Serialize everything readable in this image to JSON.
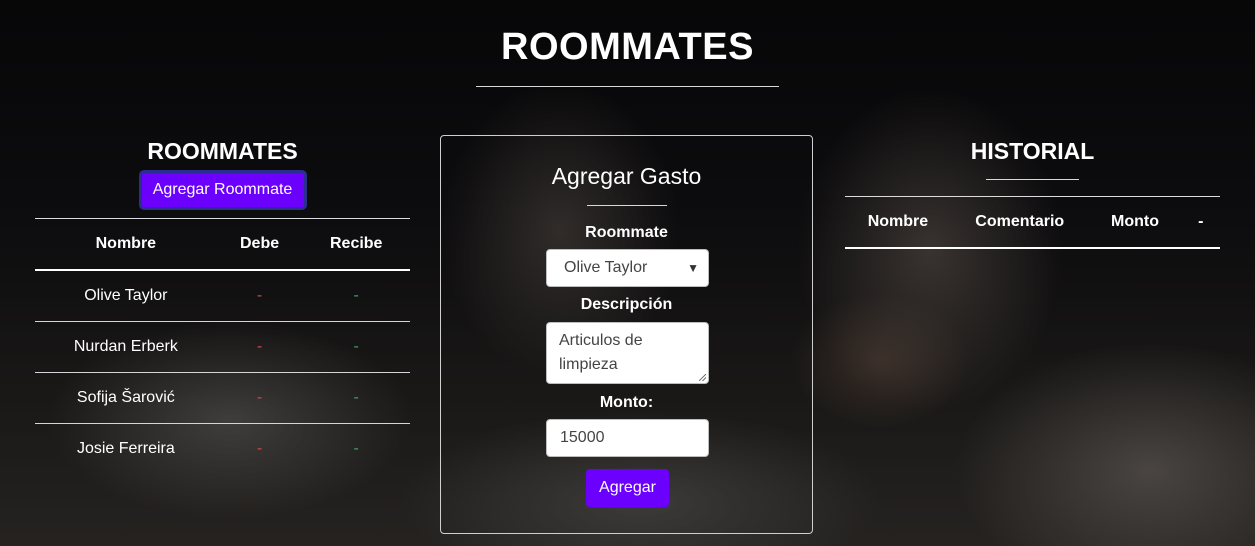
{
  "page": {
    "title": "ROOMMATES"
  },
  "roommates_section": {
    "title": "ROOMMATES",
    "add_button_label": "Agregar Roommate",
    "columns": [
      "Nombre",
      "Debe",
      "Recibe"
    ],
    "rows": [
      {
        "name": "Olive Taylor",
        "debe": "-",
        "recibe": "-"
      },
      {
        "name": "Nurdan Erberk",
        "debe": "-",
        "recibe": "-"
      },
      {
        "name": "Sofija Šarović",
        "debe": "-",
        "recibe": "-"
      },
      {
        "name": "Josie Ferreira",
        "debe": "-",
        "recibe": "-"
      }
    ]
  },
  "gasto_form": {
    "title": "Agregar Gasto",
    "roommate_label": "Roommate",
    "roommate_selected": "Olive Taylor",
    "descripcion_label": "Descripción",
    "descripcion_value": "Articulos de limpieza",
    "monto_label": "Monto:",
    "monto_value": "15000",
    "submit_label": "Agregar"
  },
  "historial_section": {
    "title": "HISTORIAL",
    "columns": [
      "Nombre",
      "Comentario",
      "Monto",
      "-"
    ]
  },
  "colors": {
    "accent": "#6c00ff",
    "debe": "#d0474b",
    "recibe": "#3fa064"
  }
}
